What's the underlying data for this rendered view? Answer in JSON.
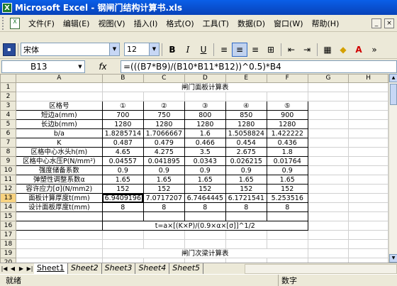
{
  "window": {
    "title": "Microsoft Excel - 钢闸门结构计算书.xls"
  },
  "menu": [
    "文件(F)",
    "编辑(E)",
    "视图(V)",
    "插入(I)",
    "格式(O)",
    "工具(T)",
    "数据(D)",
    "窗口(W)",
    "帮助(H)"
  ],
  "toolbar": {
    "font_name": "宋体",
    "font_size": "12",
    "bold": "B",
    "italic": "I",
    "underline": "U"
  },
  "formula_bar": {
    "cell_ref": "B13",
    "fx": "fx",
    "formula": "=(((B7*B9)/(B10*B11*B12))^0.5)*B4"
  },
  "columns": [
    "A",
    "B",
    "C",
    "D",
    "E",
    "F",
    "G",
    "H"
  ],
  "rows": [
    {
      "n": "1",
      "cells": [
        "",
        "闸门面板计算表",
        "",
        "",
        "",
        "",
        "",
        ""
      ]
    },
    {
      "n": "2",
      "cells": [
        "",
        "",
        "",
        "",
        "",
        "",
        "",
        ""
      ]
    },
    {
      "n": "3",
      "cells": [
        "区格号",
        "①",
        "②",
        "③",
        "④",
        "⑤",
        "",
        ""
      ]
    },
    {
      "n": "4",
      "cells": [
        "短边a(mm)",
        "700",
        "750",
        "800",
        "850",
        "900",
        "",
        ""
      ]
    },
    {
      "n": "5",
      "cells": [
        "长边b(mm)",
        "1280",
        "1280",
        "1280",
        "1280",
        "1280",
        "",
        ""
      ]
    },
    {
      "n": "6",
      "cells": [
        "b/a",
        "1.8285714",
        "1.7066667",
        "1.6",
        "1.5058824",
        "1.422222",
        "",
        ""
      ]
    },
    {
      "n": "7",
      "cells": [
        "K",
        "0.487",
        "0.479",
        "0.466",
        "0.454",
        "0.436",
        "",
        ""
      ]
    },
    {
      "n": "8",
      "cells": [
        "区格中心水头h(m)",
        "4.65",
        "4.275",
        "3.5",
        "2.675",
        "1.8",
        "",
        ""
      ]
    },
    {
      "n": "9",
      "cells": [
        "区格中心水压P(N/mm²)",
        "0.04557",
        "0.041895",
        "0.0343",
        "0.026215",
        "0.01764",
        "",
        ""
      ]
    },
    {
      "n": "10",
      "cells": [
        "强度储备系数",
        "0.9",
        "0.9",
        "0.9",
        "0.9",
        "0.9",
        "",
        ""
      ]
    },
    {
      "n": "11",
      "cells": [
        "弹塑性调整系数α",
        "1.65",
        "1.65",
        "1.65",
        "1.65",
        "1.65",
        "",
        ""
      ]
    },
    {
      "n": "12",
      "cells": [
        "容许应力[σ](N/mm2)",
        "152",
        "152",
        "152",
        "152",
        "152",
        "",
        ""
      ]
    },
    {
      "n": "13",
      "cells": [
        "面板计算厚度t(mm)",
        "6.9409196",
        "7.0717207",
        "6.7464445",
        "6.1721541",
        "5.253516",
        "",
        ""
      ]
    },
    {
      "n": "14",
      "cells": [
        "设计面板厚度t(mm)",
        "8",
        "8",
        "8",
        "8",
        "8",
        "",
        ""
      ]
    },
    {
      "n": "15",
      "cells": [
        "",
        "",
        "",
        "",
        "",
        "",
        "",
        ""
      ]
    },
    {
      "n": "16",
      "cells": [
        "",
        "t=a×[(K×P)/(0.9×α×[σ]]^1/2",
        "",
        "",
        "",
        "",
        "",
        ""
      ]
    },
    {
      "n": "17",
      "cells": [
        "",
        "",
        "",
        "",
        "",
        "",
        "",
        ""
      ]
    },
    {
      "n": "18",
      "cells": [
        "",
        "",
        "",
        "",
        "",
        "",
        "",
        ""
      ]
    },
    {
      "n": "19",
      "cells": [
        "",
        "闸门次梁计算表",
        "",
        "",
        "",
        "",
        "",
        ""
      ]
    },
    {
      "n": "20",
      "cells": [
        "",
        "",
        "",
        "",
        "",
        "",
        "",
        ""
      ]
    }
  ],
  "sheets": [
    "Sheet1",
    "Sheet2",
    "Sheet3",
    "Sheet4",
    "Sheet5"
  ],
  "status": {
    "left": "就绪",
    "mode": "数字"
  }
}
